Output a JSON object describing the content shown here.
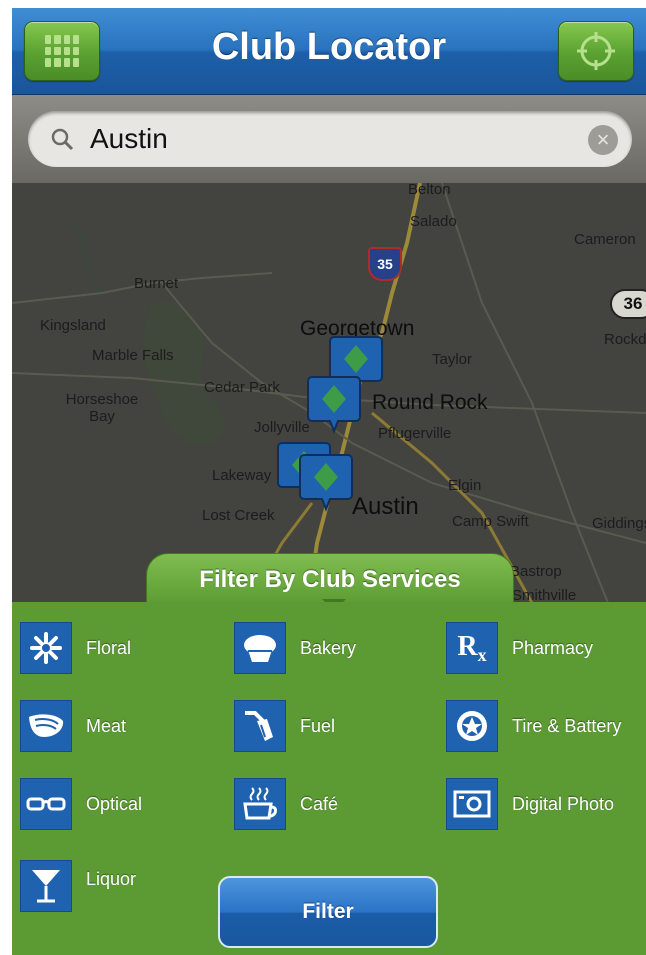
{
  "header": {
    "title": "Club Locator"
  },
  "search": {
    "value": "Austin",
    "placeholder": ""
  },
  "map": {
    "labels": [
      {
        "text": "Belton"
      },
      {
        "text": "Salado"
      },
      {
        "text": "Cameron"
      },
      {
        "text": "Burnet"
      },
      {
        "text": "Kingsland"
      },
      {
        "text": "Georgetown"
      },
      {
        "text": "Marble Falls"
      },
      {
        "text": "Taylor"
      },
      {
        "text": "Rockdale"
      },
      {
        "text": "Horseshoe Bay"
      },
      {
        "text": "Cedar Park"
      },
      {
        "text": "Round Rock"
      },
      {
        "text": "Jollyville"
      },
      {
        "text": "Pflugerville"
      },
      {
        "text": "Lakeway"
      },
      {
        "text": "Elgin"
      },
      {
        "text": "Lost Creek"
      },
      {
        "text": "Austin"
      },
      {
        "text": "Camp Swift"
      },
      {
        "text": "Giddings"
      },
      {
        "text": "Bastrop"
      },
      {
        "text": "Smithville"
      }
    ],
    "shields": {
      "interstate": "35",
      "state": "36"
    }
  },
  "filter": {
    "heading": "Filter By Club Services",
    "button_label": "Filter",
    "services": [
      {
        "label": "Floral",
        "icon": "floral-icon"
      },
      {
        "label": "Bakery",
        "icon": "bakery-icon"
      },
      {
        "label": "Pharmacy",
        "icon": "pharmacy-icon"
      },
      {
        "label": "Meat",
        "icon": "meat-icon"
      },
      {
        "label": "Fuel",
        "icon": "fuel-icon"
      },
      {
        "label": "Tire & Battery",
        "icon": "tire-battery-icon"
      },
      {
        "label": "Optical",
        "icon": "optical-icon"
      },
      {
        "label": "Café",
        "icon": "cafe-icon"
      },
      {
        "label": "Digital Photo",
        "icon": "digital-photo-icon"
      },
      {
        "label": "Liquor",
        "icon": "liquor-icon"
      }
    ]
  },
  "colors": {
    "header_blue": "#2a73bf",
    "header_button_green": "#5aa132",
    "panel_green": "#5c9b34",
    "service_icon_blue": "#1f62b0",
    "filter_button_blue": "#2a74c6",
    "map_pin_blue": "#1f62b0"
  }
}
